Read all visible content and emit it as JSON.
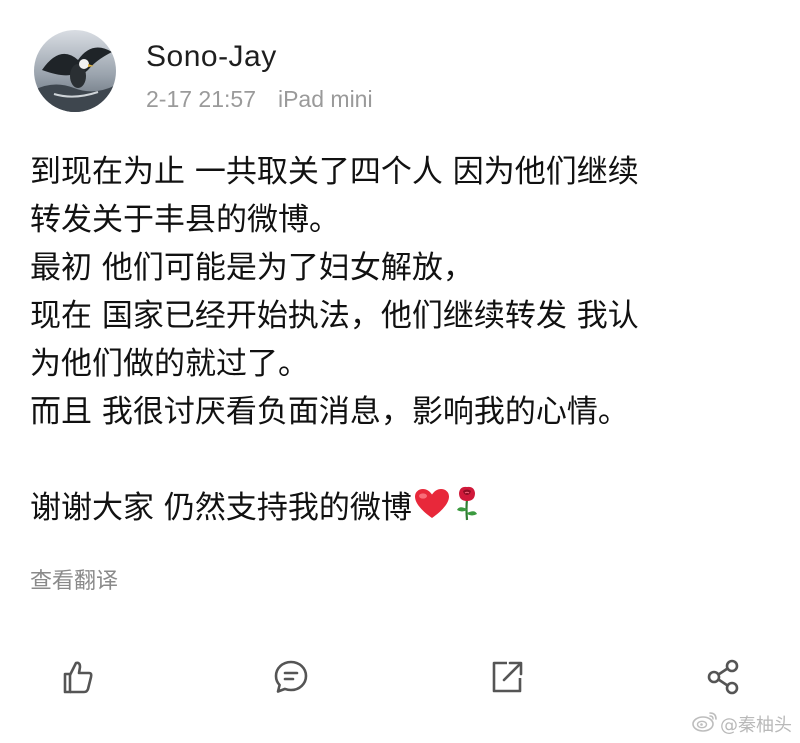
{
  "author": {
    "name": "Sono-Jay",
    "avatar_icon": "eagle-avatar"
  },
  "meta": {
    "timestamp": "2-17 21:57",
    "device": "iPad mini"
  },
  "post": {
    "lines": [
      "到现在为止 一共取关了四个人 因为他们继续",
      "转发关于丰县的微博。",
      "最初 他们可能是为了妇女解放，",
      "现在 国家已经开始执法，他们继续转发 我认",
      "为他们做的就过了。",
      "而且 我很讨厌看负面消息，影响我的心情。",
      "",
      "谢谢大家 仍然支持我的微博"
    ],
    "emojis": [
      "heart-emoji",
      "rose-emoji"
    ]
  },
  "translate_label": "查看翻译",
  "actions": {
    "like_icon": "thumbs-up-icon",
    "comment_icon": "comment-icon",
    "share_icon": "share-icon",
    "more_icon": "share-network-icon"
  },
  "watermark": {
    "text": "@秦柚头",
    "logo_icon": "weibo-logo"
  },
  "colors": {
    "text": "#111111",
    "meta": "#9a9a9a",
    "icon": "#555555",
    "heart": "#e8283a",
    "rose": "#d0193a"
  }
}
